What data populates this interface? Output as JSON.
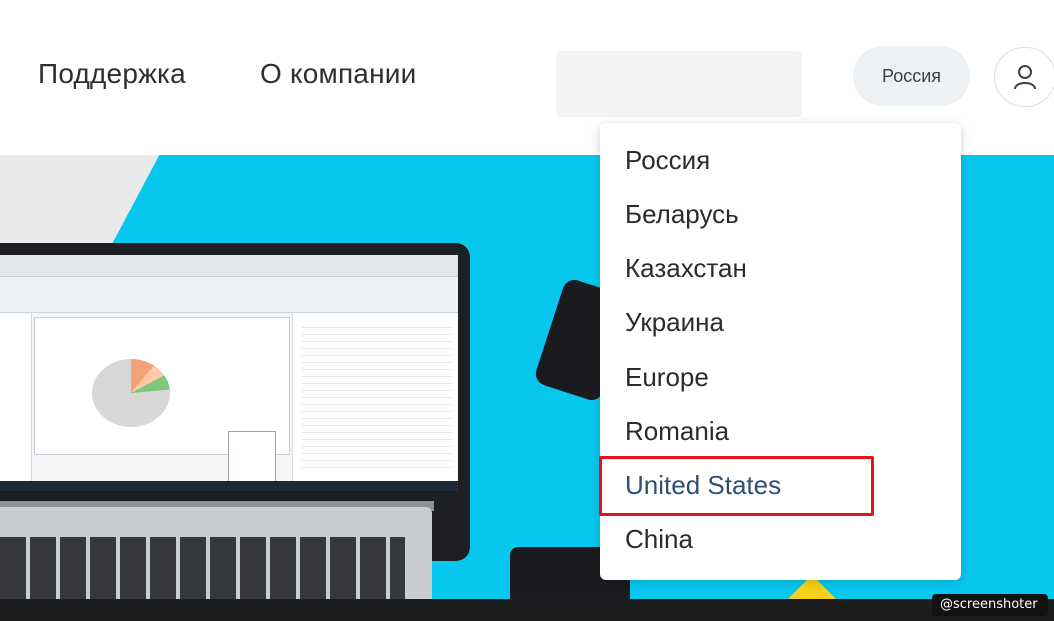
{
  "header": {
    "nav": [
      {
        "label": "Поддержка"
      },
      {
        "label": "О компании"
      }
    ],
    "region_button_label": "Россия",
    "user_icon": "user-icon"
  },
  "dropdown": {
    "items": [
      {
        "label": "Россия"
      },
      {
        "label": "Беларусь"
      },
      {
        "label": "Казахстан"
      },
      {
        "label": "Украина"
      },
      {
        "label": "Europe"
      },
      {
        "label": "Romania"
      },
      {
        "label": "United States",
        "highlighted": true
      },
      {
        "label": "China"
      }
    ],
    "highlight_color": "#e8101a",
    "active_text_color": "#2f4f73"
  },
  "hero": {
    "background_color": "#07c7ef"
  },
  "watermark": {
    "text": "@screenshoter"
  }
}
